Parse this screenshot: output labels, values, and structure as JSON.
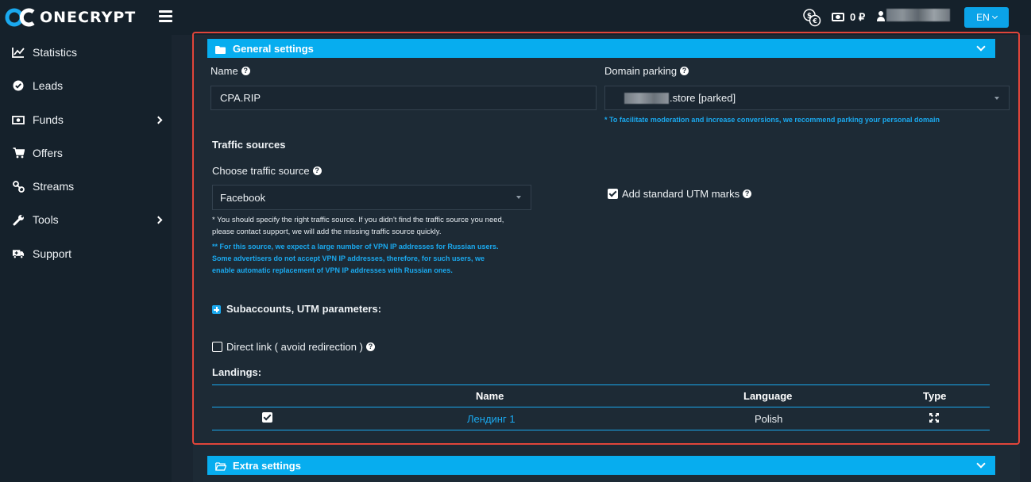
{
  "brand": {
    "name": "ONECRYPT"
  },
  "header": {
    "balance": "0 ₽",
    "language": "EN",
    "icons": [
      "menu-icon",
      "currency-exchange-icon",
      "money-icon",
      "user-icon"
    ]
  },
  "sidebar": {
    "items": [
      {
        "label": "Statistics",
        "icon": "chart-line-icon",
        "has_arrow": false
      },
      {
        "label": "Leads",
        "icon": "check-circle-icon",
        "has_arrow": false
      },
      {
        "label": "Funds",
        "icon": "money-icon",
        "has_arrow": true
      },
      {
        "label": "Offers",
        "icon": "cart-icon",
        "has_arrow": false
      },
      {
        "label": "Streams",
        "icon": "link-icon",
        "has_arrow": false
      },
      {
        "label": "Tools",
        "icon": "wrench-icon",
        "has_arrow": true
      },
      {
        "label": "Support",
        "icon": "ambulance-icon",
        "has_arrow": false
      }
    ]
  },
  "general": {
    "title": "General settings",
    "name_label": "Name",
    "name_value": "CPA.RIP",
    "domain_label": "Domain parking",
    "domain_value": ".store [parked]",
    "domain_note": "* To facilitate moderation and increase conversions, we recommend parking your personal domain",
    "traffic_heading": "Traffic sources",
    "choose_source_label": "Choose traffic source",
    "source_value": "Facebook",
    "source_note_line1": "* You should specify the right traffic source. If you didn't find the traffic source you need,",
    "source_note_line2": "please contact support, we will add the missing traffic source quickly.",
    "vpn_note_line1": "** For this source, we expect a large number of VPN IP addresses for Russian users.",
    "vpn_note_line2": "Some advertisers do not accept VPN IP addresses, therefore, for such users, we",
    "vpn_note_line3": "enable automatic replacement of VPN IP addresses with Russian ones.",
    "utm_label": "Add standard UTM marks",
    "utm_checked": true,
    "subaccounts_label": "Subaccounts, UTM parameters:",
    "direct_link_label": "Direct link ( avoid redirection )",
    "direct_link_checked": false,
    "landings_label": "Landings:"
  },
  "landings_table": {
    "columns": [
      "Name",
      "Language",
      "Type"
    ],
    "rows": [
      {
        "checked": true,
        "name": "Лендинг 1",
        "language": "Polish",
        "type_icon": "expand-icon"
      }
    ]
  },
  "extra": {
    "title": "Extra settings"
  },
  "colors": {
    "accent": "#07adef",
    "highlight_border": "#e0453a",
    "background": "#1a2530"
  }
}
